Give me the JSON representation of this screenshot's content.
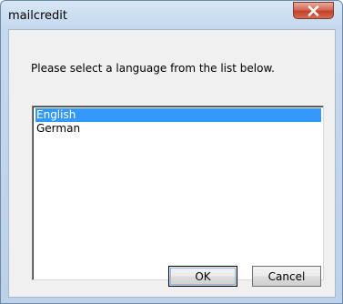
{
  "window": {
    "title": "mailcredit"
  },
  "dialog": {
    "prompt": "Please select a language from the list below.",
    "languages": [
      {
        "label": "English",
        "selected": true
      },
      {
        "label": "German",
        "selected": false
      }
    ],
    "ok_label": "OK",
    "cancel_label": "Cancel"
  },
  "colors": {
    "selection": "#3399ff",
    "close_button": "#c2412a"
  },
  "icons": {
    "close": "close-icon"
  }
}
